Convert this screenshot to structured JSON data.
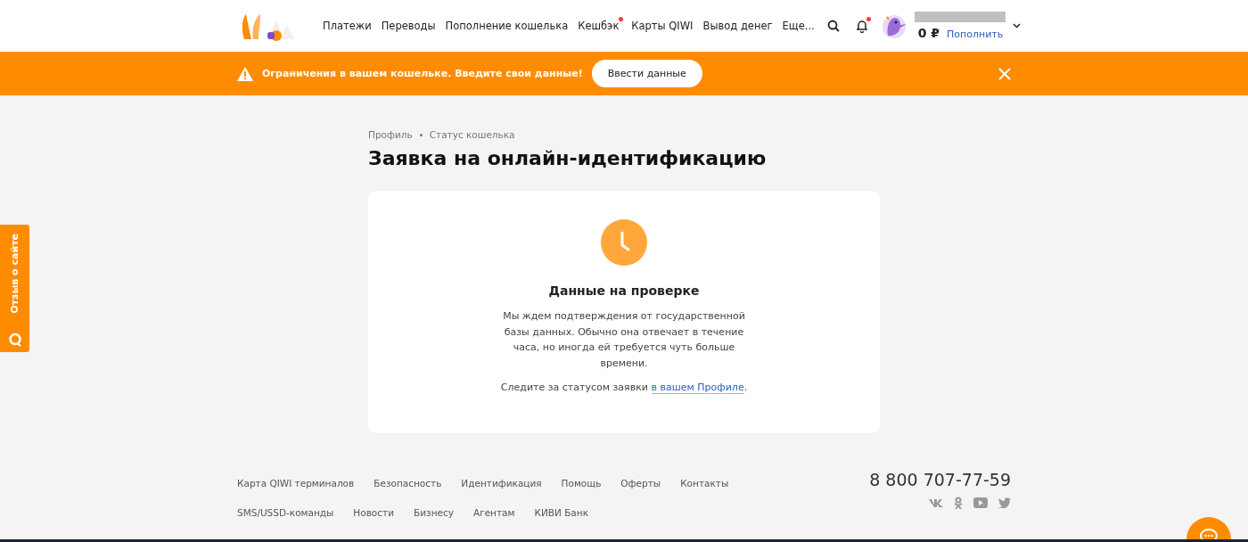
{
  "header": {
    "nav": [
      {
        "label": "Платежи",
        "badge": false
      },
      {
        "label": "Переводы",
        "badge": false
      },
      {
        "label": "Пополнение кошелька",
        "badge": false
      },
      {
        "label": "Кешбэк",
        "badge": true
      },
      {
        "label": "Карты QIWI",
        "badge": false
      },
      {
        "label": "Вывод денег",
        "badge": false
      },
      {
        "label": "Еще...",
        "badge": false
      }
    ],
    "notifications_badge": true,
    "balance": "0 ₽",
    "topup_link": "Пополнить"
  },
  "banner": {
    "message": "Ограничения в вашем кошельке. Введите свои данные!",
    "button": "Ввести данные"
  },
  "breadcrumbs": [
    "Профиль",
    "Статус кошелька"
  ],
  "title": "Заявка на онлайн-идентификацию",
  "card": {
    "heading": "Данные на проверке",
    "text": "Мы ждем подтверждения от государственной базы данных. Обычно она отвечает в течение часа, но иногда ей требуется чуть больше времени.",
    "follow_text": "Следите за статусом заявки",
    "follow_link": "в вашем Профиле",
    "follow_end": "."
  },
  "feedback_tab": "Отзыв о сайте",
  "footer": {
    "links_row_1": [
      "Карта QIWI терминалов",
      "Безопасность",
      "Идентификация",
      "Помощь",
      "Оферты",
      "Контакты"
    ],
    "links_row_2": [
      "SMS/USSD-команды",
      "Новости",
      "Бизнесу",
      "Агентам",
      "КИВИ Банк"
    ],
    "phone": "8 800 707-77-59"
  }
}
